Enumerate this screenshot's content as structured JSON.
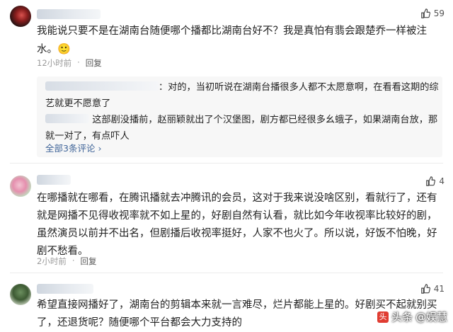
{
  "comments": [
    {
      "likes": "59",
      "text": "我能说只要不是在湖南台随便哪个播都比湖南台好不？我是真怕有翡会跟楚乔一样被注水。",
      "emoji": "🙂",
      "time": "12小时前",
      "reply": "回复",
      "replies": [
        {
          "text": "：对的，当初听说在湖南台播很多人都不太愿意啊，在看看这期的综艺就更不愿意了"
        },
        {
          "text": "这部剧没播前，赵丽颖就出了个汉堡图，剧方都已经很多幺蛾子，如果湖南台放，那就一对了，有点吓人"
        }
      ],
      "all_replies": "全部3条评论"
    },
    {
      "likes": "4",
      "text": "在哪播就在哪看，在腾讯播就去冲腾讯的会员，这对于我来说没啥区别，看就行了，还有就是网播不见得收视率就不如上星的，好剧自然有认看，就比如今年收视率比较好的剧，虽然演员以前并不出名，但剧播后收视率挺好，人家不也火了。所以说，好饭不怕晚，好剧不愁看。",
      "time": "2小时前",
      "reply": "回复"
    },
    {
      "likes": "41",
      "text": "希望直接网播好了，湖南台的剪辑本来就一言难尽，烂片都能上星的。好剧买不起就别买了，还退货呢？随便哪个平台都会大力支持的"
    }
  ],
  "watermark": {
    "brand": "头条",
    "account": "@娱慧"
  }
}
